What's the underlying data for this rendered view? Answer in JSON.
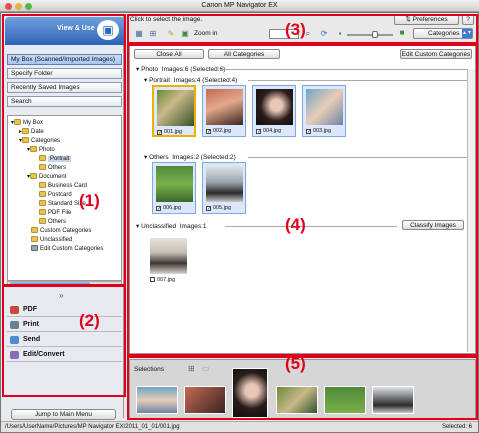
{
  "window": {
    "title": "Canon MP Navigator EX"
  },
  "sidebar": {
    "tab_label": "View & Use",
    "menu": [
      {
        "label": "My Box (Scanned/Imported Images)"
      },
      {
        "label": "Specify Folder"
      },
      {
        "label": "Recently Saved Images"
      },
      {
        "label": "Search"
      }
    ],
    "tree": [
      {
        "label": "My Box"
      },
      {
        "label": "Date"
      },
      {
        "label": "Categories"
      },
      {
        "label": "Photo"
      },
      {
        "label": "Portrait"
      },
      {
        "label": "Others"
      },
      {
        "label": "Document"
      },
      {
        "label": "Business Card"
      },
      {
        "label": "Postcard"
      },
      {
        "label": "Standard Size"
      },
      {
        "label": "PDF File"
      },
      {
        "label": "Others"
      },
      {
        "label": "Custom Categories"
      },
      {
        "label": "Unclassified"
      },
      {
        "label": "Edit Custom Categories"
      }
    ],
    "tasks": [
      {
        "label": "PDF"
      },
      {
        "label": "Print"
      },
      {
        "label": "Send"
      },
      {
        "label": "Edit/Convert"
      }
    ],
    "jump_label": "Jump to Main Menu"
  },
  "header": {
    "hint": "Click to select the image.",
    "preferences_label": "Preferences",
    "help_label": "?"
  },
  "toolbar": {
    "zoom_label": "Zoom in",
    "category_select": "Categories"
  },
  "main": {
    "close_all_label": "Close All",
    "all_categories_label": "All Categories",
    "edit_custom_label": "Edit Custom Categories",
    "photo_header": "Photo",
    "photo_count": "Images:6",
    "photo_selected": "(Selected:6)",
    "portrait_header": "Portrait",
    "portrait_count": "Images:4",
    "portrait_selected": "(Selected:4)",
    "portrait_items": [
      {
        "name": "001.jpg"
      },
      {
        "name": "002.jpg"
      },
      {
        "name": "004.jpg"
      },
      {
        "name": "003.jpg"
      }
    ],
    "others_header": "Others",
    "others_count": "Images:2",
    "others_selected": "(Selected:2)",
    "others_items": [
      {
        "name": "006.jpg"
      },
      {
        "name": "005.jpg"
      }
    ],
    "unclassified_header": "Unclassified",
    "unclassified_count": "Images:1",
    "classify_label": "Classify Images",
    "unclassified_items": [
      {
        "name": "007.jpg"
      }
    ]
  },
  "selections": {
    "label": "Selections"
  },
  "status": {
    "path": "/Users/UserName/Pictures/MP Navigator EX/2011_01_01/001.jpg",
    "selected": "Selected: 6"
  },
  "callouts": {
    "one": "(1)",
    "two": "(2)",
    "three": "(3)",
    "four": "(4)",
    "five": "(5)"
  },
  "colors": {
    "accent": "#2d63b6",
    "callout": "#e0001b",
    "selected_thumb": "#dbe8fb"
  }
}
